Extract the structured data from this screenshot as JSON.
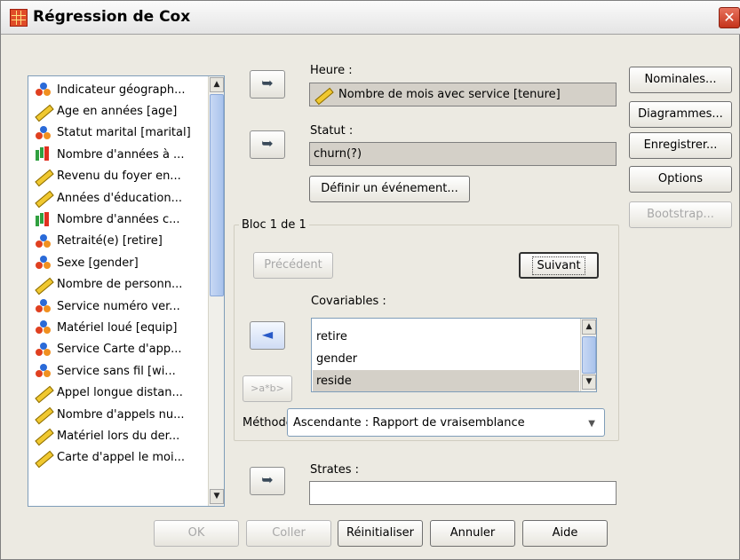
{
  "window": {
    "title": "Régression de Cox",
    "close_symbol": "✕"
  },
  "variables": [
    {
      "label": "Indicateur géograph...",
      "icon": "nominal"
    },
    {
      "label": "Age en années [age]",
      "icon": "scale"
    },
    {
      "label": "Statut marital [marital]",
      "icon": "nominal"
    },
    {
      "label": "Nombre d'années à ...",
      "icon": "ordinal"
    },
    {
      "label": "Revenu du foyer en...",
      "icon": "scale"
    },
    {
      "label": "Années d'éducation...",
      "icon": "scale"
    },
    {
      "label": "Nombre d'années c...",
      "icon": "ordinal"
    },
    {
      "label": "Retraité(e) [retire]",
      "icon": "nominal"
    },
    {
      "label": "Sexe [gender]",
      "icon": "nominal"
    },
    {
      "label": "Nombre de personn...",
      "icon": "scale"
    },
    {
      "label": "Service numéro ver...",
      "icon": "nominal"
    },
    {
      "label": "Matériel loué [equip]",
      "icon": "nominal"
    },
    {
      "label": "Service Carte d'app...",
      "icon": "nominal"
    },
    {
      "label": "Service sans fil [wi...",
      "icon": "nominal"
    },
    {
      "label": "Appel longue distan...",
      "icon": "scale"
    },
    {
      "label": "Nombre d'appels nu...",
      "icon": "scale"
    },
    {
      "label": "Matériel lors du der...",
      "icon": "scale"
    },
    {
      "label": "Carte d'appel le moi...",
      "icon": "scale"
    }
  ],
  "time": {
    "label": "Heure :",
    "value": "Nombre de mois avec service [tenure]"
  },
  "status": {
    "label": "Statut :",
    "value": "churn(?)",
    "define_event_button": "Définir un événement..."
  },
  "block": {
    "title": "Bloc 1 de 1",
    "previous_button": "Précédent",
    "next_button": "Suivant",
    "interaction_button": ">a*b>"
  },
  "covariates": {
    "label": "Covariables :",
    "items": [
      "retire",
      "gender",
      "reside"
    ],
    "selected": "reside"
  },
  "method": {
    "label": "Méthode :",
    "value": "Ascendante : Rapport de vraisemblance"
  },
  "strata": {
    "label": "Strates :",
    "value": ""
  },
  "side_buttons": {
    "nominal": "Nominales...",
    "plots": "Diagrammes...",
    "save": "Enregistrer...",
    "options": "Options",
    "bootstrap": "Bootstrap..."
  },
  "bottom_buttons": {
    "ok": "OK",
    "paste": "Coller",
    "reset": "Réinitialiser",
    "cancel": "Annuler",
    "help": "Aide"
  },
  "icons": {
    "move_right": "➥",
    "move_left": "◄"
  }
}
